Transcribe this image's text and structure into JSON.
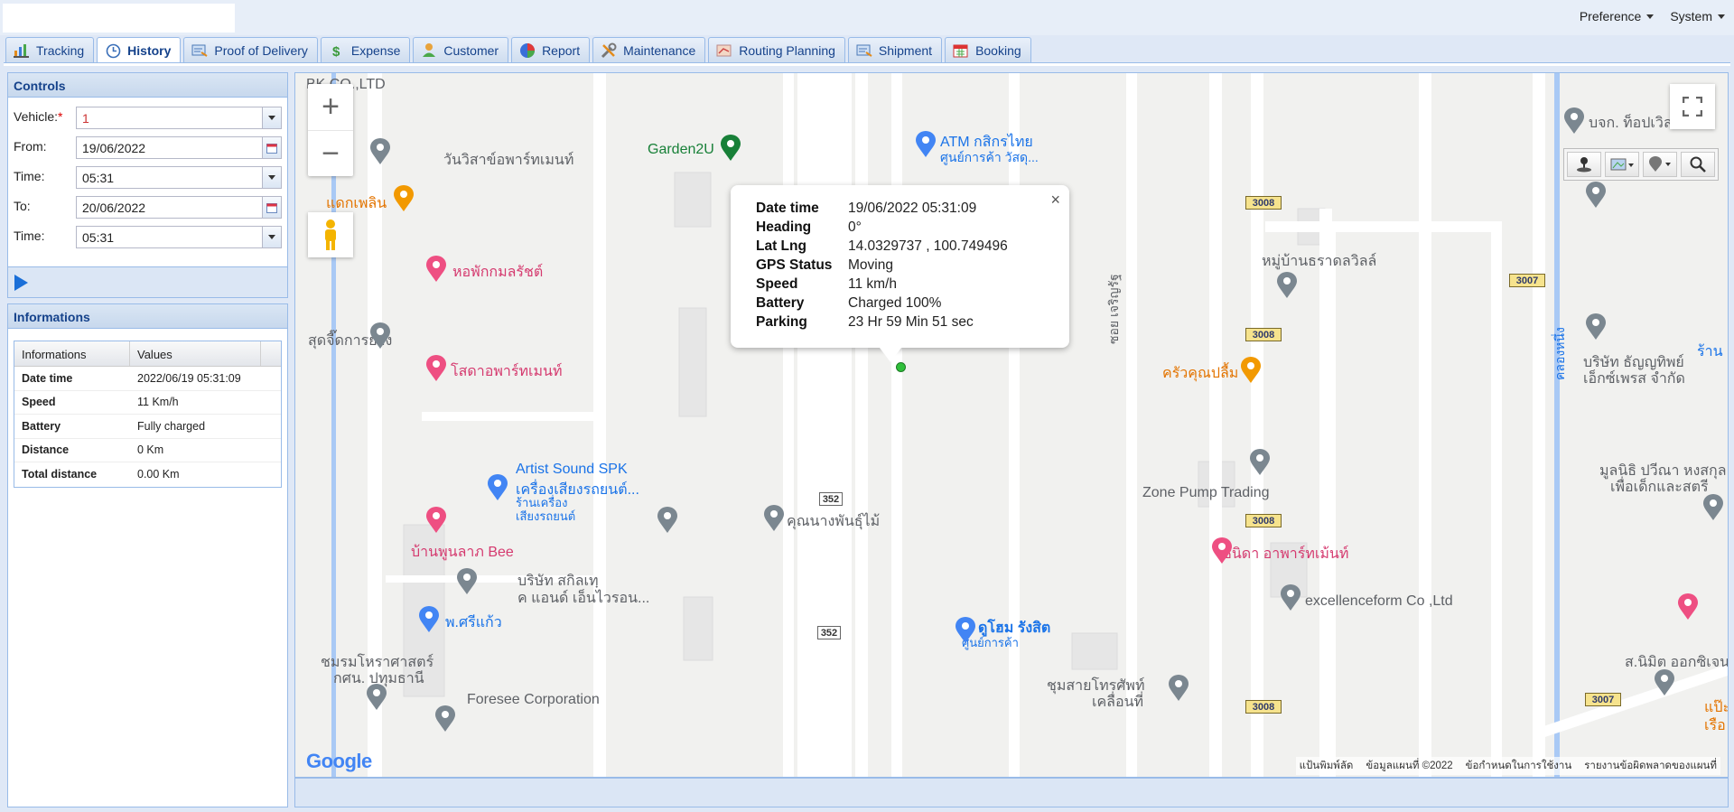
{
  "topmenu": {
    "preference": "Preference",
    "system": "System"
  },
  "tabs": [
    {
      "label": "Tracking",
      "icon": "tracking-icon"
    },
    {
      "label": "History",
      "icon": "history-icon",
      "active": true
    },
    {
      "label": "Proof of Delivery",
      "icon": "delivery-icon"
    },
    {
      "label": "Expense",
      "icon": "dollar-icon"
    },
    {
      "label": "Customer",
      "icon": "customer-icon"
    },
    {
      "label": "Report",
      "icon": "pie-chart-icon"
    },
    {
      "label": "Maintenance",
      "icon": "tools-icon"
    },
    {
      "label": "Routing Planning",
      "icon": "routing-icon"
    },
    {
      "label": "Shipment",
      "icon": "shipment-icon"
    },
    {
      "label": "Booking",
      "icon": "calendar-icon"
    }
  ],
  "controls": {
    "title": "Controls",
    "vehicle_label": "Vehicle:",
    "vehicle_required": "*",
    "vehicle_value": "1",
    "from_label": "From:",
    "from_value": "19/06/2022",
    "time1_label": "Time:",
    "time1_value": "05:31",
    "to_label": "To:",
    "to_value": "20/06/2022",
    "time2_label": "Time:",
    "time2_value": "05:31"
  },
  "informations": {
    "title": "Informations",
    "col_info": "Informations",
    "col_values": "Values",
    "rows": [
      {
        "k": "Date time",
        "v": "2022/06/19 05:31:09"
      },
      {
        "k": "Speed",
        "v": "11 Km/h"
      },
      {
        "k": "Battery",
        "v": "Fully charged"
      },
      {
        "k": "Distance",
        "v": "0 Km"
      },
      {
        "k": "Total distance",
        "v": "0.00 Km"
      }
    ]
  },
  "popup": {
    "rows": [
      {
        "k": "Date time",
        "v": "19/06/2022 05:31:09"
      },
      {
        "k": "Heading",
        "v": "0°"
      },
      {
        "k": "Lat Lng",
        "v": "14.0329737 , 100.749496"
      },
      {
        "k": "GPS Status",
        "v": "Moving"
      },
      {
        "k": "Speed",
        "v": "11 km/h"
      },
      {
        "k": "Battery",
        "v": "Charged 100%"
      },
      {
        "k": "Parking",
        "v": "23 Hr 59 Min 51 sec"
      }
    ],
    "close": "×"
  },
  "map": {
    "labels": {
      "pk": "BK CO.,LTD",
      "garden": "Garden2U",
      "atm1": "ATM กสิกรไทย",
      "atm2": "ศูนย์การค้า วัสดุ...",
      "wanwisa": "วันวิสาข์อพาร์ทเมนท์",
      "daeng": "แดกเพลิน",
      "hor": "หอพักกมลรัชต์",
      "sut": "สุดจี๊ดการยาง",
      "sota": "โสดาอพาร์ทเมนท์",
      "artist1": "Artist Sound SPK",
      "artist2": "เครื่องเสียงรถยนต์...",
      "artist3": "ร้านเครื่อง",
      "artist4": "เสียงรถยนต์",
      "khun": "คุณนางพันธุ์ไม้",
      "ban": "บ้านพูนลาภ Bee",
      "borisat1": "บริษัท สกิลเทฺ",
      "borisat2": "ค แอนด์ เอ็นไวรอน...",
      "prikaew": "พ.ศรีแก้ว",
      "chomrom1": "ชมรมโหราศาสตร์",
      "chomrom2": "กศน. ปทุมธานี",
      "foresee": "Foresee Corporation",
      "dohome1": "ดูโฮม รังสิต",
      "dohome2": "ศูนย์การค้า",
      "mooban": "หมู่บ้านธราดลวิลล์",
      "krua": "ครัวคุณปลื้ม",
      "zone": "Zone Pump Trading",
      "chanida": "ชนิดา อาพาร์ทเม้นท์",
      "excellence": "excellenceform Co ,Ltd",
      "chumsai1": "ชุมสายโทรศัพท์",
      "chumsai2": "เคลื่อนที่",
      "borjor": "บจก. ท็อปเวิลด์",
      "tanyathip1": "บริษัท ธัญญทิพย์",
      "tanyathip2": "เอ็กซ์เพรส จำกัด",
      "mulanithi1": "มูลนิธิ ปวีณา หงสกุล",
      "mulanithi2": "เพื่อเด็กและสตรี",
      "nimit": "ส.นิมิต ออกซิเจน",
      "soi": "ซอย เจริญรัฐ",
      "khlong": "คลองหนึ่ง",
      "rang": "ร้าน",
      "pao": "แป๊ะ",
      "ruea": "เรือ"
    },
    "shields": [
      "3008",
      "3008",
      "3007",
      "3008",
      "3008",
      "3008",
      "3007",
      "352",
      "352"
    ],
    "attribution": [
      "แป้นพิมพ์ลัด",
      "ข้อมูลแผนที่ ©2022",
      "ข้อกำหนดในการใช้งาน",
      "รายงานข้อผิดพลาดของแผนที่"
    ],
    "google": "Google"
  }
}
